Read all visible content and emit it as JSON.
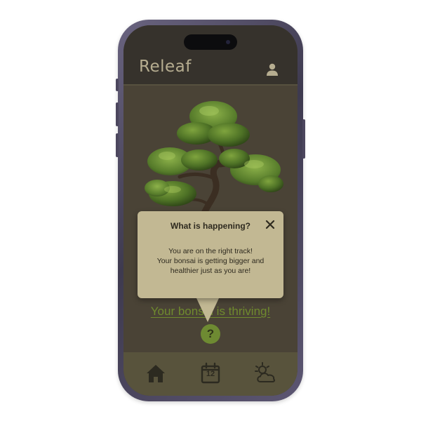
{
  "app": {
    "title": "Releaf"
  },
  "header": {
    "profile_icon": "user-icon"
  },
  "main": {
    "image": "bonsai-tree-illustration",
    "status_text": "Your bonsai is thriving!",
    "help_label": "?"
  },
  "popup": {
    "title": "What is happening?",
    "close_icon": "close-icon",
    "message_lines": [
      "You are on the right track!",
      "Your bonsai is getting bigger and",
      "healthier just as you are!"
    ]
  },
  "nav": {
    "items": [
      {
        "icon": "home-icon"
      },
      {
        "icon": "calendar-icon",
        "number": "12"
      },
      {
        "icon": "weather-icon"
      }
    ]
  },
  "colors": {
    "header_bg": "#36322c",
    "main_bg": "#4a4336",
    "nav_bg": "#58533c",
    "popup_bg": "#c2b893",
    "accent_green": "#6f8a2e",
    "title_color": "#b6ad90"
  }
}
